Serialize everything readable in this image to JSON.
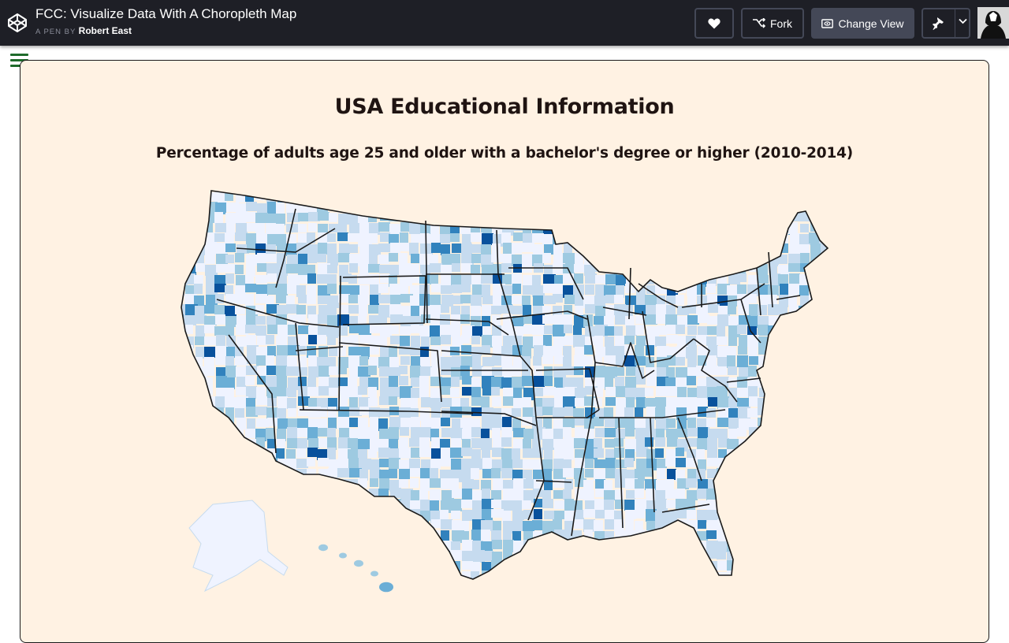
{
  "header": {
    "pen_title": "FCC: Visualize Data With A Choropleth Map",
    "byline_prefix": "A PEN BY",
    "author": "Robert East",
    "fork_label": "Fork",
    "change_view_label": "Change View"
  },
  "icons": {
    "logo": "codepen-logo-icon",
    "heart": "heart-icon",
    "fork": "fork-icon",
    "view": "eye-icon",
    "pin": "pin-icon",
    "chevron": "chevron-down-icon",
    "menu": "hamburger-menu-icon"
  },
  "colors": {
    "topbar": "#1e1f26",
    "card_background": "#fff2e3",
    "menu_icon": "#1f6b2b",
    "scale": [
      "#eff3ff",
      "#c6dbef",
      "#9ecae1",
      "#6baed6",
      "#3182bd",
      "#08519c"
    ]
  },
  "content": {
    "title": "USA Educational Information",
    "description": "Percentage of adults age 25 and older with a bachelor's degree or higher (2010-2014)"
  }
}
